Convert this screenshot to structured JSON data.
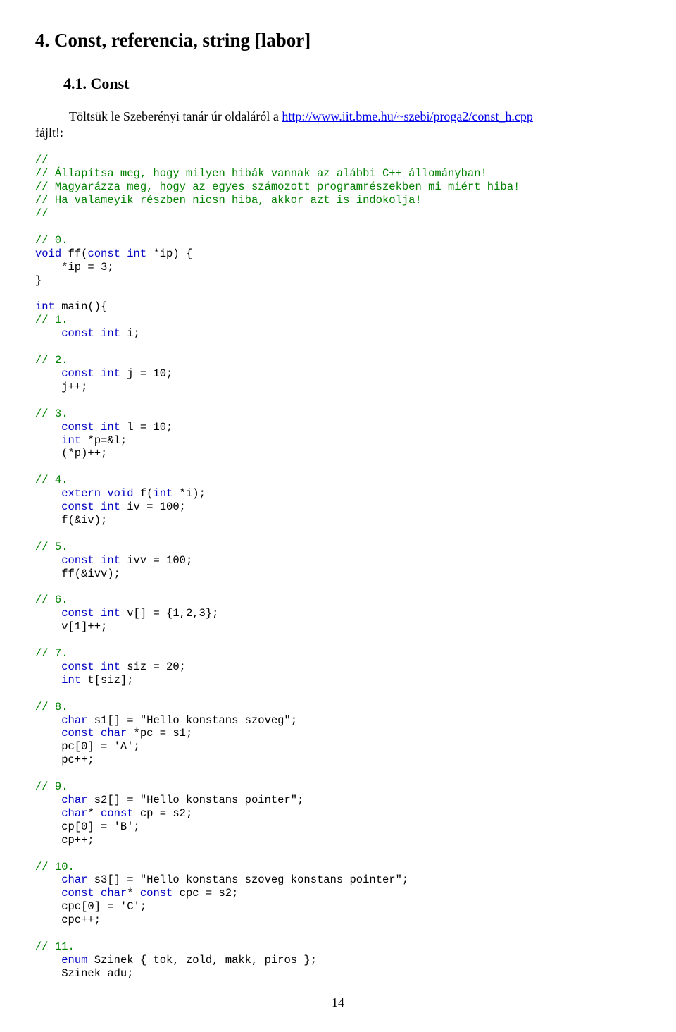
{
  "heading": "4. Const, referencia, string [labor]",
  "subheading": "4.1. Const",
  "intro_prefix": "Töltsük le Szeberényi tanár úr oldaláról a ",
  "intro_link": "http://www.iit.bme.hu/~szebi/proga2/const_h.cpp",
  "intro_suffix_line2": "fájlt!:",
  "page_number": "14",
  "code": {
    "c0": "//",
    "c1": "// Állapítsa meg, hogy milyen hibák vannak az alábbi C++ állományban!",
    "c2": "// Magyarázza meg, hogy az egyes számozott programrészekben mi miért hiba!",
    "c3": "// Ha valameyik részben nicsn hiba, akkor azt is indokolja!",
    "c4": "//",
    "c5": "// 0.",
    "l6a": "void",
    "l6b": " ff(",
    "l6c": "const int",
    "l6d": " *ip) {",
    "l7": "    *ip = 3;",
    "l8": "}",
    "l9a": "int",
    "l9b": " main(){",
    "c10": "// 1.",
    "l11a": "    ",
    "l11b": "const int",
    "l11c": " i;",
    "c12": "// 2.",
    "l13a": "    ",
    "l13b": "const int",
    "l13c": " j = 10;",
    "l14": "    j++;",
    "c15": "// 3.",
    "l16a": "    ",
    "l16b": "const int",
    "l16c": " l = 10;",
    "l17a": "    ",
    "l17b": "int",
    "l17c": " *p=&l;",
    "l18": "    (*p)++;",
    "c19": "// 4.",
    "l20a": "    ",
    "l20b": "extern void",
    "l20c": " f(",
    "l20d": "int",
    "l20e": " *i);",
    "l21a": "    ",
    "l21b": "const int",
    "l21c": " iv = 100;",
    "l22": "    f(&iv);",
    "c23": "// 5.",
    "l24a": "    ",
    "l24b": "const int",
    "l24c": " ivv = 100;",
    "l25": "    ff(&ivv);",
    "c26": "// 6.",
    "l27a": "    ",
    "l27b": "const int",
    "l27c": " v[] = {1,2,3};",
    "l28": "    v[1]++;",
    "c29": "// 7.",
    "l30a": "    ",
    "l30b": "const int",
    "l30c": " siz = 20;",
    "l31a": "    ",
    "l31b": "int",
    "l31c": " t[siz];",
    "c32": "// 8.",
    "l33a": "    ",
    "l33b": "char",
    "l33c": " s1[] = \"Hello konstans szoveg\";",
    "l34a": "    ",
    "l34b": "const char",
    "l34c": " *pc = s1;",
    "l35": "    pc[0] = 'A';",
    "l36": "    pc++;",
    "c37": "// 9.",
    "l38a": "    ",
    "l38b": "char",
    "l38c": " s2[] = \"Hello konstans pointer\";",
    "l39a": "    ",
    "l39b": "char",
    "l39c": "* ",
    "l39d": "const",
    "l39e": " cp = s2;",
    "l40": "    cp[0] = 'B';",
    "l41": "    cp++;",
    "c42": "// 10.",
    "l43a": "    ",
    "l43b": "char",
    "l43c": " s3[] = \"Hello konstans szoveg konstans pointer\";",
    "l44a": "    ",
    "l44b": "const char",
    "l44c": "* ",
    "l44d": "const",
    "l44e": " cpc = s2;",
    "l45": "    cpc[0] = 'C';",
    "l46": "    cpc++;",
    "c47": "// 11.",
    "l48a": "    ",
    "l48b": "enum",
    "l48c": " Szinek { tok, zold, makk, piros };",
    "l49": "    Szinek adu;"
  }
}
